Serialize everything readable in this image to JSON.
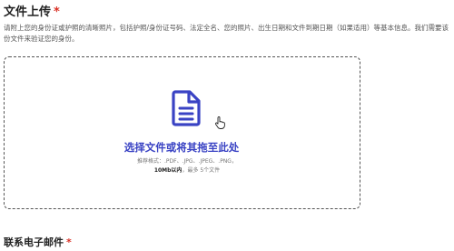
{
  "upload_section": {
    "title": "文件上传",
    "required_mark": "*",
    "description": "请附上您的身份证或护照的清晰照片，包括护照/身份证号码、法定全名、您的照片、出生日期和文件到期日期（如果适用）等基本信息。我们需要该份文件来验证您的身份。"
  },
  "dropzone": {
    "icon": "document-icon",
    "cursor_icon": "hand-pointer-icon",
    "title": "选择文件或将其拖至此处",
    "formats_prefix": "推荐格式：.PDF、.JPG、.JPEG、.PNG，",
    "formats_limit": "10Mb以内",
    "formats_suffix": "，最多 5个文件",
    "accent_color": "#3a43c4"
  },
  "email_section": {
    "title": "联系电子邮件",
    "required_mark": "*"
  }
}
